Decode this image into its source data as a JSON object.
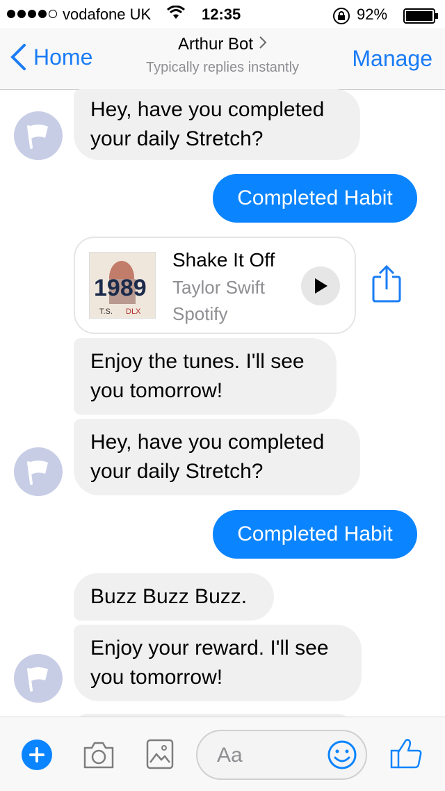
{
  "status_bar": {
    "carrier": "vodafone UK",
    "time": "12:35",
    "battery": "92%"
  },
  "nav": {
    "back_label": "Home",
    "title": "Arthur Bot",
    "subtitle": "Typically replies instantly",
    "manage_label": "Manage"
  },
  "messages": {
    "m1": "Hey, have you completed your daily Stretch?",
    "m2": "Completed Habit",
    "m4": "Enjoy the tunes. I'll see you tomorrow!",
    "m5": "Hey, have you completed your daily Stretch?",
    "m6": "Completed Habit",
    "m7": "Buzz Buzz Buzz.",
    "m8": "Enjoy your reward. I'll see you tomorrow!"
  },
  "music_card": {
    "title": "Shake It Off",
    "artist": "Taylor Swift",
    "source": "Spotify",
    "album_text": "1989",
    "album_initials": "T.S.",
    "album_edition": "DLX"
  },
  "composer": {
    "placeholder": "Aa"
  },
  "colors": {
    "accent": "#0a84ff",
    "incoming_bubble": "#f1f0f0",
    "avatar": "#c8cde6",
    "nav_bg": "#f8f8f8"
  }
}
